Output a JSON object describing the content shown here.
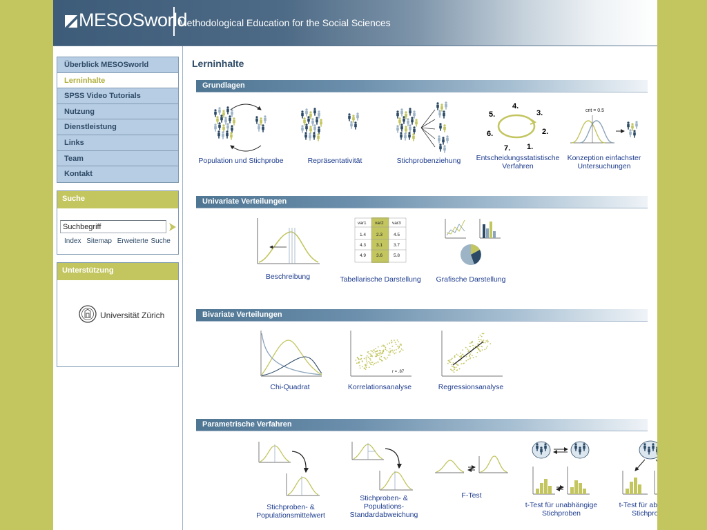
{
  "header": {
    "logo": "MESOSworld",
    "tagline": "Methodological Education for the Social Sciences"
  },
  "nav": {
    "items": [
      {
        "label": "Überblick MESOSworld",
        "active": false
      },
      {
        "label": "Lerninhalte",
        "active": true
      },
      {
        "label": "SPSS Video Tutorials",
        "active": false
      },
      {
        "label": "Nutzung",
        "active": false
      },
      {
        "label": "Dienstleistung",
        "active": false
      },
      {
        "label": "Links",
        "active": false
      },
      {
        "label": "Team",
        "active": false
      },
      {
        "label": "Kontakt",
        "active": false
      }
    ]
  },
  "search": {
    "title": "Suche",
    "value": "Suchbegriff",
    "links": [
      "Index",
      "Sitemap",
      "Erweiterte Suche"
    ]
  },
  "support": {
    "title": "Unterstützung",
    "partner": "Universität Zürich"
  },
  "colors": {
    "page_bg": "#c3c55f",
    "nav_bg": "#b7cde4",
    "nav_text": "#2e4a66",
    "active_text": "#b0ae3c",
    "caption": "#1d3c8e",
    "header_blue": "#3d5c79"
  },
  "content": {
    "title": "Lerninhalte",
    "sections": [
      {
        "title": "Grundlagen",
        "items": [
          {
            "label": "Population und Stichprobe",
            "icon": "population-sample-icon"
          },
          {
            "label": "Repräsentativität",
            "icon": "representativeness-icon"
          },
          {
            "label": "Stichprobenziehung",
            "icon": "sampling-icon"
          },
          {
            "label": "Entscheidungsstatistische Verfahren",
            "icon": "decision-cycle-icon",
            "steps": [
              "4.",
              "3.",
              "5.",
              "2.",
              "6.",
              "7.",
              "1."
            ]
          },
          {
            "label": "Konzeption einfachster Untersuchungen",
            "icon": "study-design-icon",
            "annotation": "crit = 0.5"
          }
        ]
      },
      {
        "title": "Univariate Verteilungen",
        "items": [
          {
            "label": "Beschreibung",
            "icon": "distribution-description-icon"
          },
          {
            "label": "Tabellarische Darstellung",
            "icon": "table-icon",
            "table": {
              "headers": [
                "var1",
                "var2",
                "var3"
              ],
              "rows": [
                [
                  "1.4",
                  "2.3",
                  "4.5"
                ],
                [
                  "4.3",
                  "3.1",
                  "3.7"
                ],
                [
                  "4.9",
                  "3.6",
                  "5.8"
                ]
              ]
            }
          },
          {
            "label": "Grafische Darstellung",
            "icon": "graphics-icon"
          }
        ]
      },
      {
        "title": "Bivariate Verteilungen",
        "items": [
          {
            "label": "Chi-Quadrat",
            "icon": "chi-square-icon"
          },
          {
            "label": "Korrelationsanalyse",
            "icon": "correlation-icon",
            "annotation": "r = .87"
          },
          {
            "label": "Regressionsanalyse",
            "icon": "regression-icon"
          }
        ]
      },
      {
        "title": "Parametrische Verfahren",
        "items": [
          {
            "label": "Stichproben- & Populationsmittelwert",
            "icon": "mean-comparison-icon"
          },
          {
            "label": "Stichproben- & Populations-Standardabweichung",
            "icon": "sd-comparison-icon"
          },
          {
            "label": "F-Test",
            "icon": "f-test-icon"
          },
          {
            "label": "t-Test für unabhängige Stichproben",
            "icon": "t-test-independent-icon"
          },
          {
            "label": "t-Test für abhängige Stichproben",
            "icon": "t-test-dependent-icon"
          }
        ]
      }
    ]
  }
}
